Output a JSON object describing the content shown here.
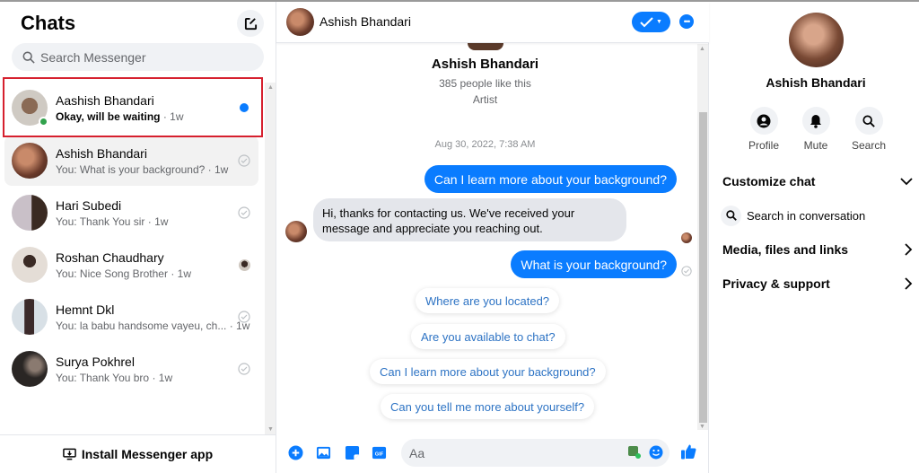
{
  "left": {
    "title": "Chats",
    "search_placeholder": "Search Messenger",
    "install_label": "Install Messenger app",
    "chats": [
      {
        "name": "Aashish Bhandari",
        "preview": "Okay, will be waiting",
        "time": "· 1w",
        "unread": true,
        "online": true,
        "status": "unread-dot"
      },
      {
        "name": "Ashish Bhandari",
        "preview": "You: What is your background?",
        "time": "· 1w",
        "status": "sent-check"
      },
      {
        "name": "Hari Subedi",
        "preview": "You: Thank You sir",
        "time": "· 1w",
        "status": "sent-check"
      },
      {
        "name": "Roshan Chaudhary",
        "preview": "You: Nice Song Brother",
        "time": "· 1w",
        "status": "seen-avatar"
      },
      {
        "name": "Hemnt Dkl",
        "preview": "You: la babu handsome vayeu, ch...",
        "time": "· 1w",
        "status": "sent-check"
      },
      {
        "name": "Surya Pokhrel",
        "preview": "You: Thank You bro",
        "time": "· 1w",
        "status": "sent-check"
      }
    ]
  },
  "conversation": {
    "header_name": "Ashish Bhandari",
    "profile_name": "Ashish Bhandari",
    "profile_likes": "385 people like this",
    "profile_category": "Artist",
    "timestamp": "Aug 30, 2022, 7:38 AM",
    "messages": [
      {
        "from": "me",
        "text": "Can I learn more about your background?"
      },
      {
        "from": "them",
        "text": "Hi, thanks for contacting us. We've received your message and appreciate you reaching out."
      },
      {
        "from": "me",
        "text": "What is your background?"
      }
    ],
    "suggestions": [
      "Where are you located?",
      "Are you available to chat?",
      "Can I learn more about your background?",
      "Can you tell me more about yourself?"
    ],
    "composer_placeholder": "Aa"
  },
  "details": {
    "name": "Ashish Bhandari",
    "actions": [
      "Profile",
      "Mute",
      "Search"
    ],
    "sections": {
      "customize": "Customize chat",
      "search_in": "Search in conversation",
      "media": "Media, files and links",
      "privacy": "Privacy & support"
    }
  },
  "colors": {
    "accent": "#0a7cff",
    "highlight_border": "#d6202e",
    "online": "#31a24c"
  }
}
